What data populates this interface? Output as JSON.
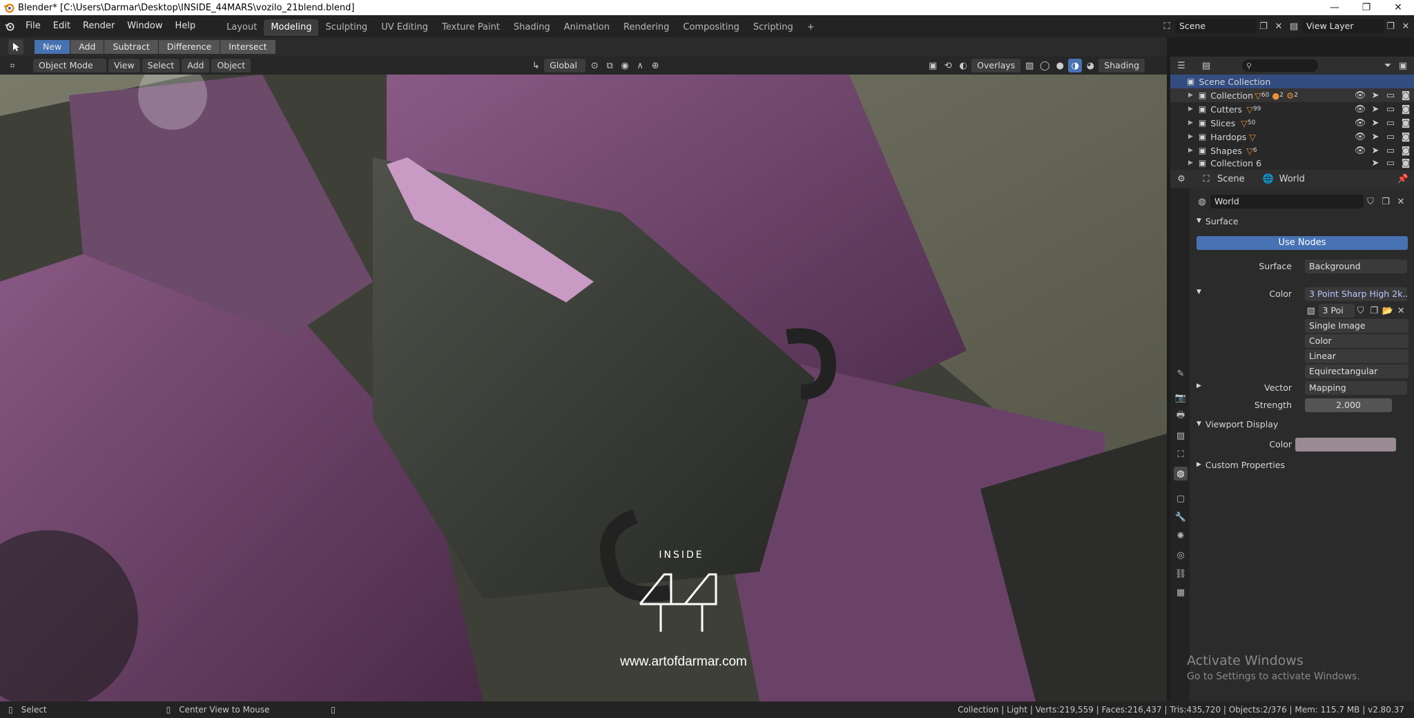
{
  "window": {
    "title": "Blender* [C:\\Users\\Darmar\\Desktop\\INSIDE_44MARS\\vozilo_21blend.blend]",
    "minimize": "—",
    "restore": "❐",
    "close": "✕"
  },
  "menu": [
    "File",
    "Edit",
    "Render",
    "Window",
    "Help"
  ],
  "workspaces": [
    "Layout",
    "Modeling",
    "Sculpting",
    "UV Editing",
    "Texture Paint",
    "Shading",
    "Animation",
    "Rendering",
    "Compositing",
    "Scripting"
  ],
  "active_workspace": "Modeling",
  "add_workspace": "+",
  "scene_name": "Scene",
  "view_layer": "View Layer",
  "boolean_tools": [
    "New",
    "Add",
    "Subtract",
    "Difference",
    "Intersect"
  ],
  "viewport_header": {
    "mode": "Object Mode",
    "menus": [
      "View",
      "Select",
      "Add",
      "Object"
    ],
    "orientation": "Global",
    "overlays": "Overlays",
    "shading": "Shading"
  },
  "watermark": {
    "brand_top": "INSIDE",
    "url": "www.artofdarmar.com"
  },
  "activate_windows": {
    "title": "Activate Windows",
    "subtitle": "Go to Settings to activate Windows."
  },
  "outliner": {
    "root": "Scene Collection",
    "items": [
      {
        "name": "Collection",
        "count": "60",
        "extra1": "2",
        "extra2": "2"
      },
      {
        "name": "Cutters",
        "count": "99"
      },
      {
        "name": "Slices",
        "count": "50"
      },
      {
        "name": "Hardops",
        "count": ""
      },
      {
        "name": "Shapes",
        "count": "6"
      },
      {
        "name": "Collection 6",
        "count": ""
      }
    ]
  },
  "properties": {
    "breadcrumb_scene": "Scene",
    "breadcrumb_world": "World",
    "world_name": "World",
    "surface_panel": "Surface",
    "use_nodes": "Use Nodes",
    "surface_label": "Surface",
    "surface_value": "Background",
    "color_label": "Color",
    "color_value": "3 Point Sharp High 2k...",
    "image_name": "3 Poi",
    "dropdowns": [
      "Single Image",
      "Color",
      "Linear",
      "Equirectangular"
    ],
    "vector_label": "Vector",
    "vector_value": "Mapping",
    "strength_label": "Strength",
    "strength_value": "2.000",
    "viewport_display": "Viewport Display",
    "vd_color_label": "Color",
    "custom_properties": "Custom Properties"
  },
  "statusbar": {
    "left": "Select",
    "middle": "Center View to Mouse",
    "stats": "Collection | Light | Verts:219,559 | Faces:216,437 | Tris:435,720 | Objects:2/376 | Mem: 115.7 MB | v2.80.37"
  },
  "colors": {
    "accent": "#4772b3",
    "header": "#232323",
    "panel": "#2b2b2b"
  }
}
